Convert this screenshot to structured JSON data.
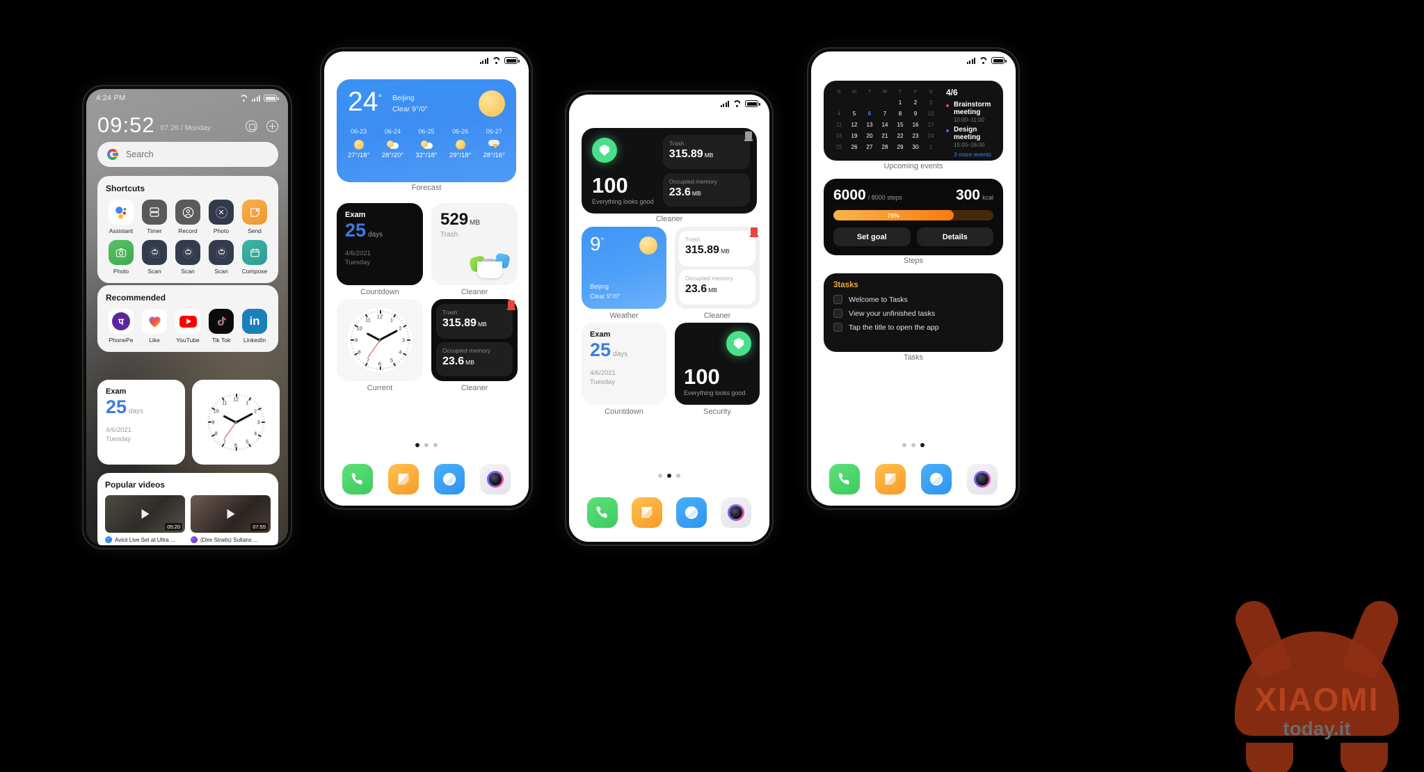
{
  "watermark": {
    "line1": "XIAOMI",
    "line2": "today.it"
  },
  "phone1": {
    "status": {
      "time": "4:24 PM"
    },
    "clock": "09:52",
    "date": "07.26 / Monday",
    "search": {
      "placeholder": "Search"
    },
    "shortcuts": {
      "title": "Shortcuts",
      "items": [
        {
          "label": "Assistant",
          "icon": "google-assistant-icon"
        },
        {
          "label": "Timer",
          "icon": "timer-icon"
        },
        {
          "label": "Record",
          "icon": "record-icon"
        },
        {
          "label": "Photo",
          "icon": "photo-close-icon"
        },
        {
          "label": "Send",
          "icon": "send-note-icon"
        },
        {
          "label": "Photo",
          "icon": "camera-icon"
        },
        {
          "label": "Scan",
          "icon": "scan-icon"
        },
        {
          "label": "Scan",
          "icon": "scan-icon"
        },
        {
          "label": "Scan",
          "icon": "scan-icon"
        },
        {
          "label": "Compose",
          "icon": "calendar-icon"
        }
      ]
    },
    "recommended": {
      "title": "Recommended",
      "items": [
        {
          "label": "PhonePe",
          "icon": "phonepe-icon"
        },
        {
          "label": "Like",
          "icon": "likee-heart-icon"
        },
        {
          "label": "YouTube",
          "icon": "youtube-icon"
        },
        {
          "label": "Tik Tok",
          "icon": "tiktok-icon"
        },
        {
          "label": "LinkedIn",
          "icon": "linkedin-icon"
        }
      ]
    },
    "countdown": {
      "title": "Exam",
      "number": "25",
      "unit": "days",
      "date": "4/6/2021",
      "day": "Tuesday"
    },
    "popular": {
      "title": "Popular videos",
      "videos": [
        {
          "title": "Avicii Live Set at Ultra ...",
          "duration": "05:20"
        },
        {
          "title": "(Dire Straits) Sultans ...",
          "duration": "07:55"
        }
      ]
    }
  },
  "phone2": {
    "forecast": {
      "temp": "24",
      "degree": "°",
      "city": "Beijing",
      "condition": "Clear  9°/0°",
      "label": "Forecast",
      "days": [
        {
          "date": "06-23",
          "icon": "sun-icon",
          "temps": "27°/18°"
        },
        {
          "date": "06-24",
          "icon": "cloud-icon",
          "temps": "28°/20°"
        },
        {
          "date": "06-25",
          "icon": "cloud-icon",
          "temps": "32°/18°"
        },
        {
          "date": "06-26",
          "icon": "sun-icon",
          "temps": "29°/18°"
        },
        {
          "date": "06-27",
          "icon": "storm-icon",
          "temps": "28°/16°"
        }
      ]
    },
    "countdown": {
      "title": "Exam",
      "number": "25",
      "unit": "days",
      "date": "4/6/2021",
      "day": "Tuesday",
      "label": "Countdown"
    },
    "trash": {
      "value": "529",
      "unit": "MB",
      "caption": "Trash",
      "label": "Cleaner"
    },
    "clock": {
      "label": "Current"
    },
    "cleaner": {
      "label": "Cleaner",
      "trash_label": "Trash",
      "trash_value": "315.89",
      "trash_unit": "MB",
      "mem_label": "Occupied memory",
      "mem_value": "23.6",
      "mem_unit": "MB"
    },
    "dots": 3,
    "active_dot": 0
  },
  "phone3": {
    "cleaner": {
      "label": "Cleaner",
      "score": "100",
      "score_sub": "Everything looks good",
      "trash_label": "Trash",
      "trash_value": "315.89",
      "trash_unit": "MB",
      "mem_label": "Occupied memory",
      "mem_value": "23.6",
      "mem_unit": "MB"
    },
    "weather": {
      "label": "Weather",
      "temp": "9",
      "degree": "°",
      "city": "Beijing",
      "condition": "Clear  9°/0°"
    },
    "cleaner2": {
      "label": "Cleaner",
      "trash_label": "Trash",
      "trash_value": "315.89",
      "trash_unit": "MB",
      "mem_label": "Occupied memory",
      "mem_value": "23.6",
      "mem_unit": "MB"
    },
    "countdown": {
      "title": "Exam",
      "number": "25",
      "unit": "days",
      "date": "4/6/2021",
      "day": "Tuesday",
      "label": "Countdown"
    },
    "security": {
      "label": "Security",
      "score": "100",
      "score_sub": "Everything looks good"
    },
    "dots": 3,
    "active_dot": 1
  },
  "phone4": {
    "calendar": {
      "label": "Upcoming events",
      "weekdays": [
        "S",
        "M",
        "T",
        "W",
        "T",
        "F",
        "S"
      ],
      "weeks": [
        [
          "",
          "",
          "",
          "",
          "1",
          "2",
          "3"
        ],
        [
          "4",
          "5",
          "6",
          "7",
          "8",
          "9",
          "10"
        ],
        [
          "11",
          "12",
          "13",
          "14",
          "15",
          "16",
          "17"
        ],
        [
          "18",
          "19",
          "20",
          "21",
          "22",
          "23",
          "24"
        ],
        [
          "25",
          "26",
          "27",
          "28",
          "29",
          "30",
          "1"
        ]
      ],
      "dim": [
        "3",
        "4",
        "10",
        "11",
        "17",
        "18",
        "24",
        "25",
        "1"
      ],
      "selected": "6",
      "event_date": "4/6",
      "events": [
        {
          "title": "Brainstorm meeting",
          "time": "10:00–11:00",
          "color": "#e0465f"
        },
        {
          "title": "Design meeting",
          "time": "15:00–16:00",
          "color": "#6c5ce7"
        }
      ],
      "more": "3 more events"
    },
    "steps": {
      "label": "Steps",
      "current": "6000",
      "goal": "/ 8000 steps",
      "kcal": "300",
      "kcal_unit": "kcal",
      "percent": "75%",
      "percent_value": 75,
      "set_goal": "Set goal",
      "details": "Details"
    },
    "tasks": {
      "label": "Tasks",
      "header": "3tasks",
      "items": [
        "Welcome to Tasks",
        "View your unfinished tasks",
        "Tap the title to open the app"
      ]
    },
    "dots": 3,
    "active_dot": 2
  }
}
